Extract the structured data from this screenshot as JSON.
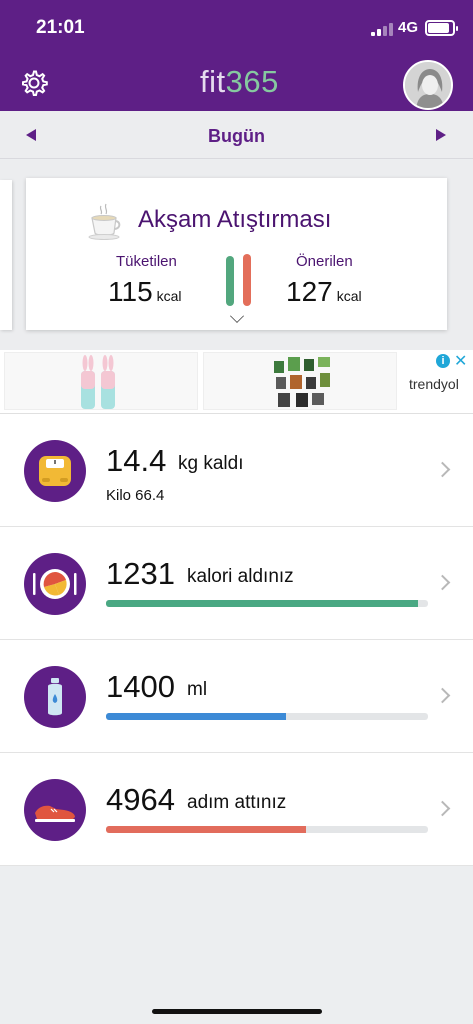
{
  "status_bar": {
    "time": "21:01",
    "network": "4G",
    "battery_level": 0.9
  },
  "header": {
    "logo_fit": "fit",
    "logo_num": "365"
  },
  "date_nav": {
    "label": "Bugün"
  },
  "meal_card": {
    "title": "Akşam Atıştırması",
    "consumed_label": "Tüketilen",
    "consumed_value": "115",
    "consumed_unit": "kcal",
    "recommended_label": "Önerilen",
    "recommended_value": "127",
    "recommended_unit": "kcal"
  },
  "ad": {
    "brand": "trendyol",
    "info": "i",
    "close": "✕"
  },
  "rows": [
    {
      "icon": "scale-icon",
      "value": "14.4",
      "unit": "kg kaldı",
      "sub": "Kilo 66.4"
    },
    {
      "icon": "plate-icon",
      "value": "1231",
      "unit": "kalori aldınız",
      "progress": 0.97,
      "color": "#4aa883"
    },
    {
      "icon": "water-bottle-icon",
      "value": "1400",
      "unit": "ml",
      "progress": 0.56,
      "color": "#3c8ad6"
    },
    {
      "icon": "sneaker-icon",
      "value": "4964",
      "unit": "adım attınız",
      "progress": 0.62,
      "color": "#e26c5c"
    }
  ],
  "colors": {
    "brand": "#5e1f86",
    "accent_green": "#86c9a0"
  }
}
